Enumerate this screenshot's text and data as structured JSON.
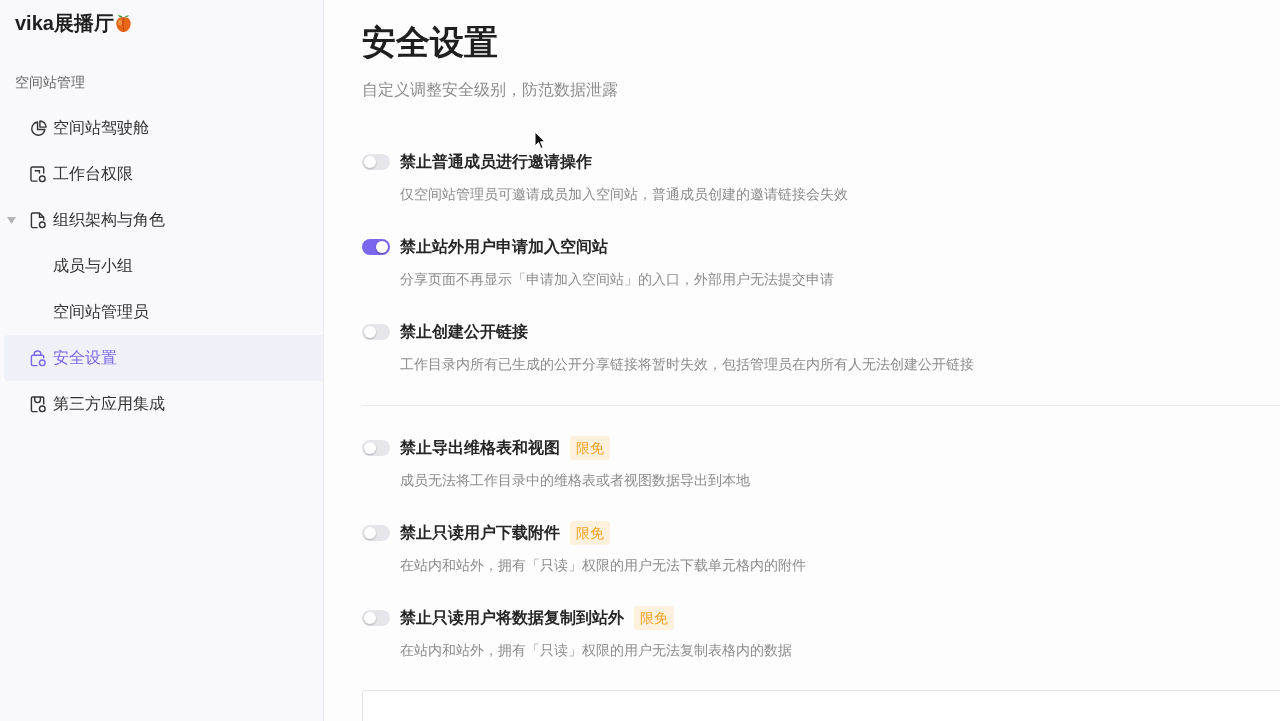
{
  "sidebar": {
    "space_name": "vika展播厅",
    "section_label": "空间站管理",
    "items": [
      {
        "label": "空间站驾驶舱",
        "kind": "dashboard",
        "selected": false
      },
      {
        "label": "工作台权限",
        "kind": "workbench",
        "selected": false
      },
      {
        "label": "组织架构与角色",
        "kind": "organization",
        "selected": false,
        "expanded": true,
        "children": [
          {
            "label": "成员与小组",
            "selected": false
          },
          {
            "label": "空间站管理员",
            "selected": false
          }
        ]
      },
      {
        "label": "安全设置",
        "kind": "security",
        "selected": true
      },
      {
        "label": "第三方应用集成",
        "kind": "integration",
        "selected": false
      }
    ]
  },
  "page": {
    "title": "安全设置",
    "subtitle": "自定义调整安全级别，防范数据泄露"
  },
  "setting_groups": [
    {
      "settings": [
        {
          "title": "禁止普通成员进行邀请操作",
          "description": "仅空间站管理员可邀请成员加入空间站，普通成员创建的邀请链接会失效",
          "on": false
        },
        {
          "title": "禁止站外用户申请加入空间站",
          "description": "分享页面不再显示「申请加入空间站」的入口，外部用户无法提交申请",
          "on": true
        },
        {
          "title": "禁止创建公开链接",
          "description": "工作目录内所有已生成的公开分享链接将暂时失效，包括管理员在内所有人无法创建公开链接",
          "on": false
        }
      ]
    },
    {
      "settings": [
        {
          "title": "禁止导出维格表和视图",
          "badge": "限免",
          "description": "成员无法将工作目录中的维格表或者视图数据导出到本地",
          "on": false
        },
        {
          "title": "禁止只读用户下载附件",
          "badge": "限免",
          "description": "在站内和站外，拥有「只读」权限的用户无法下载单元格内的附件",
          "on": false
        },
        {
          "title": "禁止只读用户将数据复制到站外",
          "badge": "限免",
          "description": "在站内和站外，拥有「只读」权限的用户无法复制表格内的数据",
          "on": false
        }
      ]
    }
  ]
}
